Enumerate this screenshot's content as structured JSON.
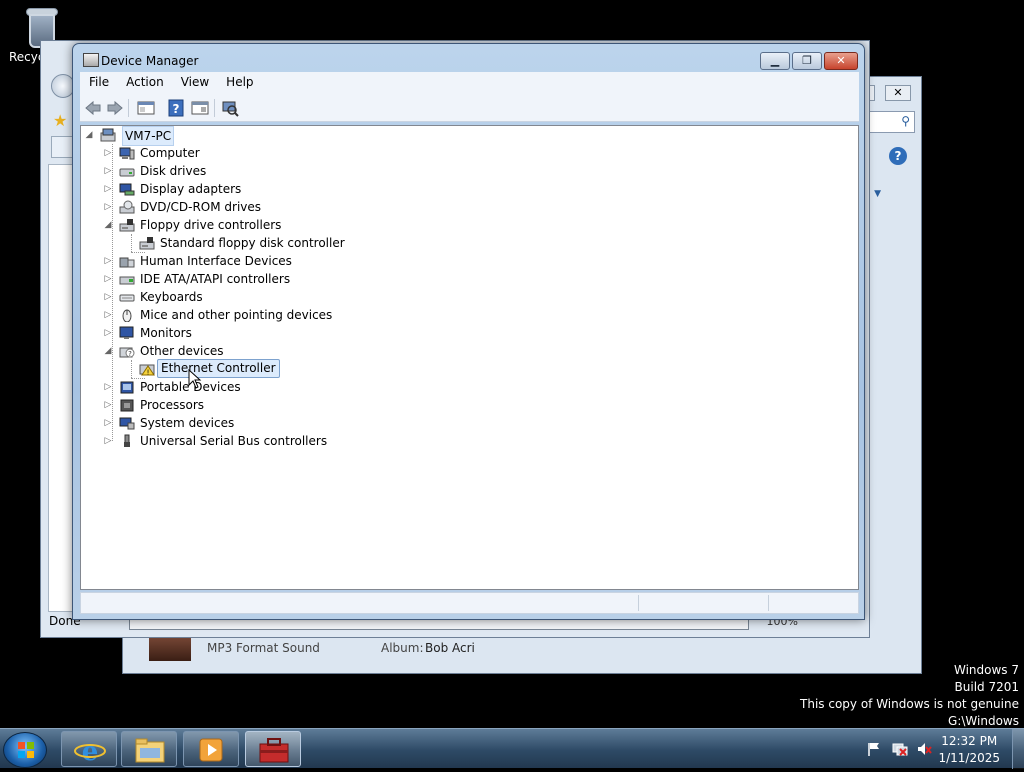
{
  "desktop": {
    "recycle_bin_label": "Recyc",
    "watermark": [
      "Windows 7",
      "Build 7201",
      "This copy of Windows is not genuine",
      "G:\\Windows"
    ]
  },
  "ie_window": {
    "status_text": "Done",
    "zoom_text": "100%"
  },
  "media_window": {
    "format_text": "MP3 Format Sound",
    "album_label": "Album:",
    "album_value": "Bob Acri"
  },
  "device_manager": {
    "title": "Device Manager",
    "menu": [
      "File",
      "Action",
      "View",
      "Help"
    ],
    "toolbar_icons": [
      "back-arrow-icon",
      "forward-arrow-icon",
      "properties-icon",
      "help-icon",
      "show-hidden-icon",
      "scan-hardware-icon"
    ],
    "root": {
      "label": "VM7-PC",
      "expanded": true
    },
    "items": [
      {
        "label": "Computer",
        "icon": "computer-icon",
        "level": 1,
        "state": "collapsed"
      },
      {
        "label": "Disk drives",
        "icon": "disk-drive-icon",
        "level": 1,
        "state": "collapsed"
      },
      {
        "label": "Display adapters",
        "icon": "display-adapter-icon",
        "level": 1,
        "state": "collapsed"
      },
      {
        "label": "DVD/CD-ROM drives",
        "icon": "dvd-drive-icon",
        "level": 1,
        "state": "collapsed"
      },
      {
        "label": "Floppy drive controllers",
        "icon": "floppy-controller-icon",
        "level": 1,
        "state": "expanded"
      },
      {
        "label": "Standard floppy disk controller",
        "icon": "floppy-controller-icon",
        "level": 2,
        "state": "leaf"
      },
      {
        "label": "Human Interface Devices",
        "icon": "hid-icon",
        "level": 1,
        "state": "collapsed"
      },
      {
        "label": "IDE ATA/ATAPI controllers",
        "icon": "ide-controller-icon",
        "level": 1,
        "state": "collapsed"
      },
      {
        "label": "Keyboards",
        "icon": "keyboard-icon",
        "level": 1,
        "state": "collapsed"
      },
      {
        "label": "Mice and other pointing devices",
        "icon": "mouse-icon",
        "level": 1,
        "state": "collapsed"
      },
      {
        "label": "Monitors",
        "icon": "monitor-icon",
        "level": 1,
        "state": "collapsed"
      },
      {
        "label": "Other devices",
        "icon": "unknown-device-icon",
        "level": 1,
        "state": "expanded"
      },
      {
        "label": "Ethernet Controller",
        "icon": "warning-device-icon",
        "level": 2,
        "state": "leaf",
        "selected": true
      },
      {
        "label": "Portable Devices",
        "icon": "portable-device-icon",
        "level": 1,
        "state": "collapsed"
      },
      {
        "label": "Processors",
        "icon": "processor-icon",
        "level": 1,
        "state": "collapsed"
      },
      {
        "label": "System devices",
        "icon": "system-device-icon",
        "level": 1,
        "state": "collapsed"
      },
      {
        "label": "Universal Serial Bus controllers",
        "icon": "usb-icon",
        "level": 1,
        "state": "collapsed"
      }
    ]
  },
  "taskbar": {
    "pinned": [
      "internet-explorer-icon",
      "windows-explorer-icon",
      "media-player-icon",
      "device-manager-toolbox-icon"
    ],
    "active_index": 3,
    "time": "12:32 PM",
    "date": "1/11/2025",
    "tray_icons": [
      "action-center-flag-icon",
      "network-disconnected-icon",
      "volume-muted-icon"
    ]
  }
}
